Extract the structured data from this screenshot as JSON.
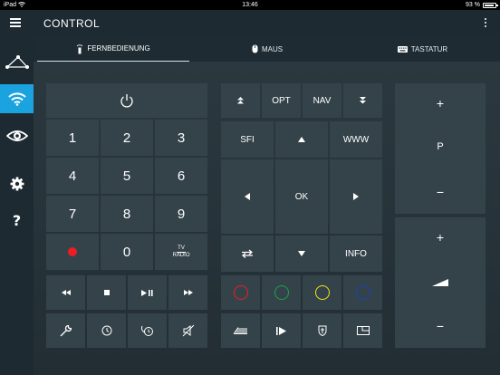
{
  "status_bar": {
    "device": "iPad",
    "wifi_icon": "wifi-icon",
    "time": "13:46",
    "battery": "93 %"
  },
  "app_bar": {
    "title": "CONTROL"
  },
  "sidebar": {
    "items": [
      {
        "name": "triangle-nodes-icon",
        "active": false
      },
      {
        "name": "wifi-icon",
        "active": true
      },
      {
        "name": "eye-icon",
        "active": false
      },
      {
        "name": "gear-icon",
        "active": false
      },
      {
        "name": "help-icon",
        "active": false
      }
    ]
  },
  "tabs": [
    {
      "label": "FERNBEDIENUNG",
      "icon": "remote-icon",
      "active": true
    },
    {
      "label": "MAUS",
      "icon": "mouse-icon",
      "active": false
    },
    {
      "label": "TASTATUR",
      "icon": "keyboard-icon",
      "active": false
    }
  ],
  "keypad": {
    "numbers": [
      "1",
      "2",
      "3",
      "4",
      "5",
      "6",
      "7",
      "8",
      "9",
      "0"
    ],
    "tv_radio": {
      "top": "TV",
      "bottom": "RADIO"
    }
  },
  "nav": {
    "opt": "OPT",
    "nav": "NAV",
    "sfi": "SFI",
    "www": "WWW",
    "ok": "OK",
    "info": "INFO"
  },
  "volume": {
    "p": "P",
    "plus": "+",
    "minus": "−"
  },
  "colors": {
    "red": "#ee1c25",
    "green": "#1fa14a",
    "yellow": "#f4e21a",
    "blue": "#1e3fb8",
    "accent": "#1aa3de"
  }
}
